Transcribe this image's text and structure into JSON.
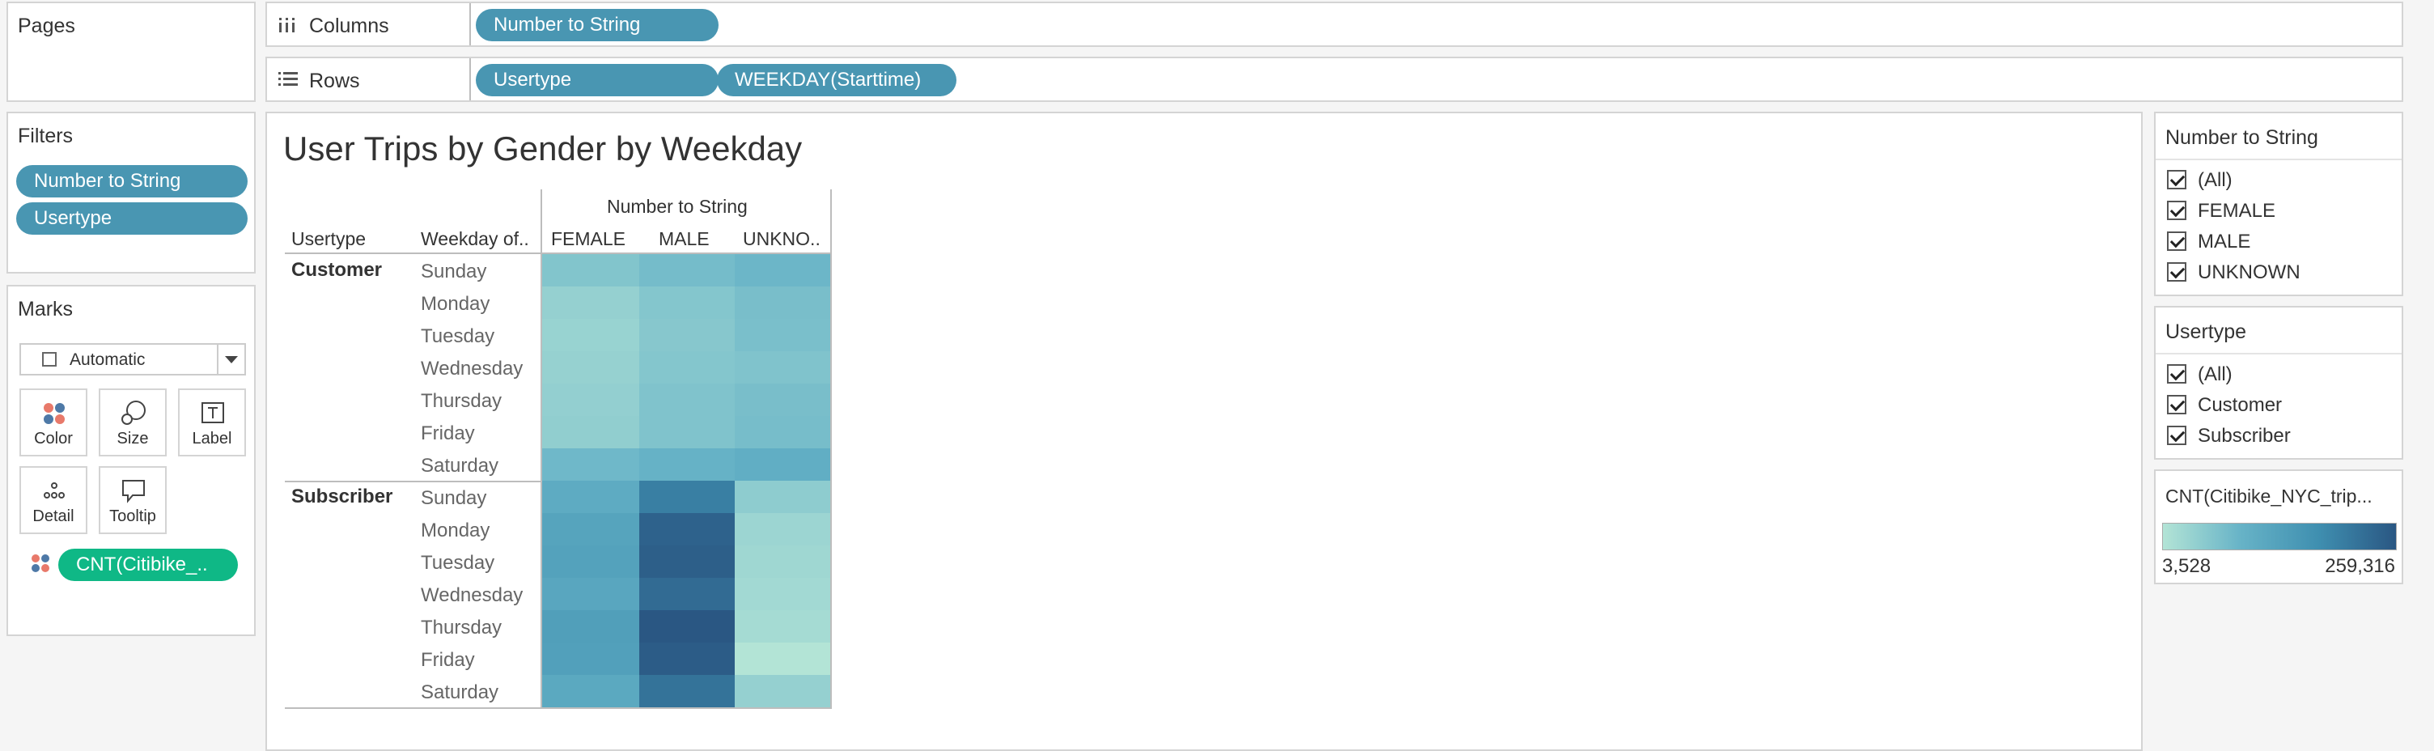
{
  "shelves": {
    "pages_title": "Pages",
    "columns_label": "Columns",
    "rows_label": "Rows",
    "columns_pills": [
      "Number to String"
    ],
    "rows_pills": [
      "Usertype",
      "WEEKDAY(Starttime)"
    ]
  },
  "filters": {
    "title": "Filters",
    "pills": [
      "Number to String",
      "Usertype"
    ]
  },
  "marks": {
    "title": "Marks",
    "mark_type": "Automatic",
    "cards": [
      "Color",
      "Size",
      "Label",
      "Detail",
      "Tooltip"
    ],
    "field_pill": "CNT(Citibike_..",
    "color_field_icon": "color-dots-icon"
  },
  "view": {
    "title": "User Trips by Gender by Weekday",
    "col_header_group": "Number to String",
    "row_header_1": "Usertype",
    "row_header_2": "Weekday of..",
    "columns": [
      "FEMALE",
      "MALE",
      "UNKNO.."
    ],
    "groups": [
      {
        "name": "Customer",
        "days": [
          "Sunday",
          "Monday",
          "Tuesday",
          "Wednesday",
          "Thursday",
          "Friday",
          "Saturday"
        ]
      },
      {
        "name": "Subscriber",
        "days": [
          "Sunday",
          "Monday",
          "Tuesday",
          "Wednesday",
          "Thursday",
          "Friday",
          "Saturday"
        ]
      }
    ]
  },
  "chart_data": {
    "type": "heatmap",
    "title": "User Trips by Gender by Weekday",
    "columns": [
      "FEMALE",
      "MALE",
      "UNKNO.."
    ],
    "rows": [
      [
        "Customer",
        "Sunday"
      ],
      [
        "Customer",
        "Monday"
      ],
      [
        "Customer",
        "Tuesday"
      ],
      [
        "Customer",
        "Wednesday"
      ],
      [
        "Customer",
        "Thursday"
      ],
      [
        "Customer",
        "Friday"
      ],
      [
        "Customer",
        "Saturday"
      ],
      [
        "Subscriber",
        "Sunday"
      ],
      [
        "Subscriber",
        "Monday"
      ],
      [
        "Subscriber",
        "Tuesday"
      ],
      [
        "Subscriber",
        "Wednesday"
      ],
      [
        "Subscriber",
        "Thursday"
      ],
      [
        "Subscriber",
        "Friday"
      ],
      [
        "Subscriber",
        "Saturday"
      ]
    ],
    "values": [
      [
        15000,
        22000,
        28000
      ],
      [
        8000,
        14000,
        20000
      ],
      [
        7000,
        13000,
        19000
      ],
      [
        7500,
        14000,
        16000
      ],
      [
        8500,
        16000,
        20000
      ],
      [
        9000,
        16000,
        21000
      ],
      [
        26000,
        33000,
        40000
      ],
      [
        45000,
        150000,
        10000
      ],
      [
        60000,
        225000,
        6000
      ],
      [
        64000,
        235000,
        5500
      ],
      [
        55000,
        200000,
        5000
      ],
      [
        70000,
        259316,
        4500
      ],
      [
        68000,
        245000,
        3528
      ],
      [
        50000,
        180000,
        8000
      ]
    ],
    "color_range": [
      3528,
      259316
    ],
    "color_low": "#b3e4d6",
    "color_high": "#2a5783"
  },
  "legends": {
    "filter1": {
      "title": "Number to String",
      "items": [
        "(All)",
        "FEMALE",
        "MALE",
        "UNKNOWN"
      ]
    },
    "filter2": {
      "title": "Usertype",
      "items": [
        "(All)",
        "Customer",
        "Subscriber"
      ]
    },
    "color": {
      "title": "CNT(Citibike_NYC_trip...",
      "min_label": "3,528",
      "max_label": "259,316"
    }
  }
}
